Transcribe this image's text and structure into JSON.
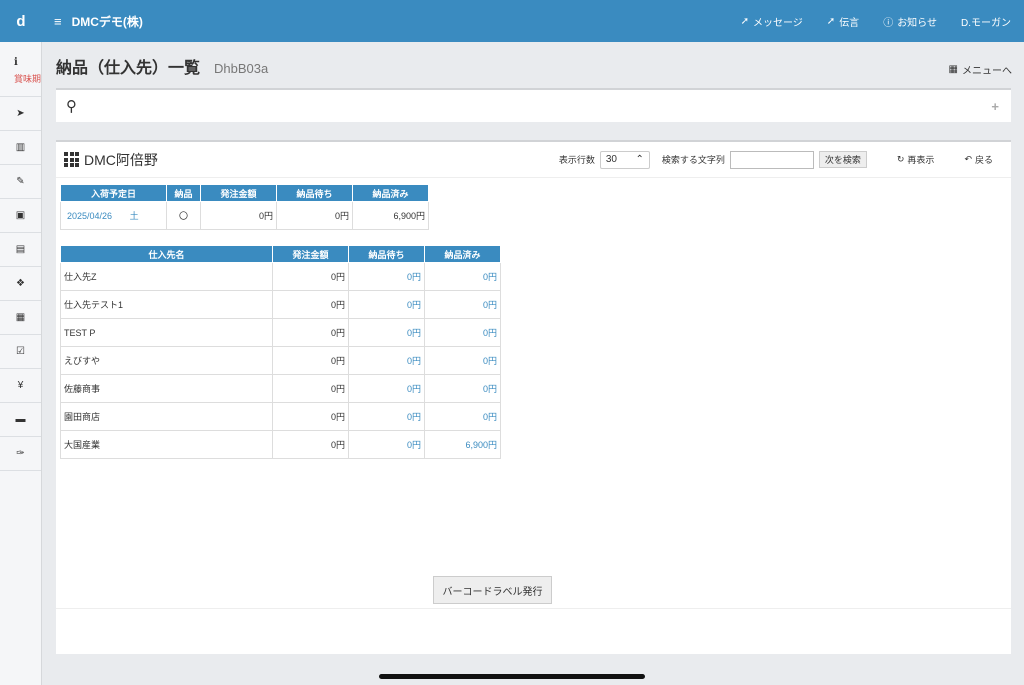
{
  "app": {
    "logo": "d",
    "hamburger": "≡",
    "company": "DMCデモ(株)"
  },
  "topnav": [
    {
      "icon": "paper-plane-icon",
      "glyph": "➚",
      "label": "メッセージ"
    },
    {
      "icon": "paper-plane-icon",
      "glyph": "➚",
      "label": "伝言"
    },
    {
      "icon": "info-circle-icon",
      "glyph": "ⓘ",
      "label": "お知らせ"
    },
    {
      "icon": "",
      "glyph": "",
      "label": "D.モーガン"
    }
  ],
  "sidebar": {
    "info_label": "賞味期",
    "info_glyph": "i",
    "items": [
      {
        "icon": "paper-plane-icon",
        "glyph": "➤"
      },
      {
        "icon": "bar-chart-icon",
        "glyph": "▥"
      },
      {
        "icon": "edit-icon",
        "glyph": "✎"
      },
      {
        "icon": "suitcase-icon",
        "glyph": "▣"
      },
      {
        "icon": "document-icon",
        "glyph": "▤"
      },
      {
        "icon": "cubes-icon",
        "glyph": "❖"
      },
      {
        "icon": "calendar-icon",
        "glyph": "▦"
      },
      {
        "icon": "calendar-check-icon",
        "glyph": "☑"
      },
      {
        "icon": "yen-icon",
        "glyph": "¥"
      },
      {
        "icon": "briefcase-icon",
        "glyph": "▬"
      },
      {
        "icon": "wrench-icon",
        "glyph": "✑"
      }
    ]
  },
  "page": {
    "title": "納品（仕入先）一覧",
    "code": "DhbB03a",
    "menu_label": "メニューへ",
    "menu_glyph": "▦"
  },
  "search": {
    "glyph": "⚲",
    "plus": "+"
  },
  "panel": {
    "title": "DMC阿倍野",
    "rows_label": "表示行数",
    "rows_value": "30",
    "search_label": "検索する文字列",
    "search_value": "",
    "next_button": "次を検索",
    "refresh_label": "再表示",
    "refresh_glyph": "↻",
    "back_label": "戻る",
    "back_glyph": "↶"
  },
  "summary_table": {
    "headers": [
      "入荷予定日",
      "納品",
      "発注金額",
      "納品待ち",
      "納品済み"
    ],
    "row": {
      "date": "2025/04/26",
      "weekday": "土",
      "delivered": "〇",
      "order_amount": "0円",
      "pending": "0円",
      "done": "6,900円"
    }
  },
  "supplier_table": {
    "headers": [
      "仕入先名",
      "発注金額",
      "納品待ち",
      "納品済み"
    ],
    "rows": [
      {
        "name": "仕入先Z",
        "order": "0円",
        "pending": "0円",
        "done": "0円"
      },
      {
        "name": "仕入先テスト1",
        "order": "0円",
        "pending": "0円",
        "done": "0円"
      },
      {
        "name": "TEST P",
        "order": "0円",
        "pending": "0円",
        "done": "0円"
      },
      {
        "name": "えびすや",
        "order": "0円",
        "pending": "0円",
        "done": "0円"
      },
      {
        "name": "佐藤商事",
        "order": "0円",
        "pending": "0円",
        "done": "0円"
      },
      {
        "name": "園田商店",
        "order": "0円",
        "pending": "0円",
        "done": "0円"
      },
      {
        "name": "大国産業",
        "order": "0円",
        "pending": "0円",
        "done": "6,900円"
      }
    ]
  },
  "footer": {
    "barcode_button": "バーコードラベル発行"
  }
}
